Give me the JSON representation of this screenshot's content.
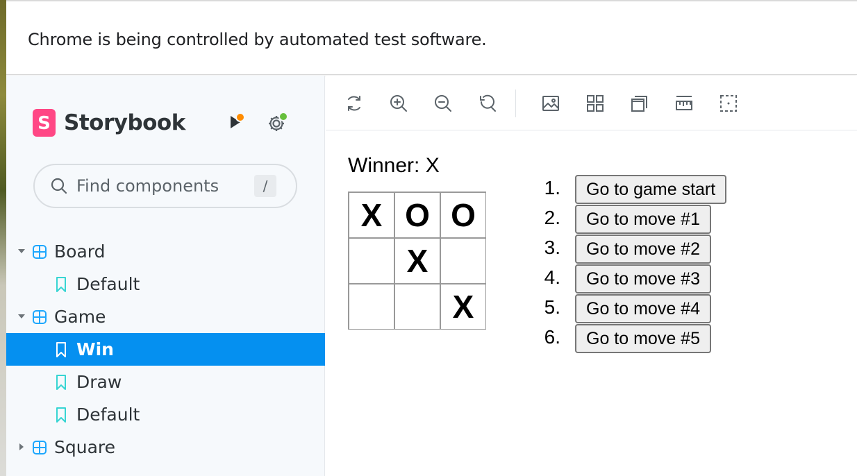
{
  "banner": {
    "text": "Chrome is being controlled by automated test software."
  },
  "sidebar": {
    "brand": "Storybook",
    "logo_letter": "S",
    "search": {
      "placeholder": "Find components",
      "shortcut": "/"
    },
    "tree": [
      {
        "label": "Board",
        "type": "component",
        "expanded": true
      },
      {
        "label": "Default",
        "type": "story"
      },
      {
        "label": "Game",
        "type": "component",
        "expanded": true
      },
      {
        "label": "Win",
        "type": "story",
        "selected": true
      },
      {
        "label": "Draw",
        "type": "story"
      },
      {
        "label": "Default",
        "type": "story"
      },
      {
        "label": "Square",
        "type": "component",
        "expanded": false
      }
    ]
  },
  "toolbar": {
    "icons": [
      "sync-icon",
      "zoom-in-icon",
      "zoom-out-icon",
      "zoom-reset-icon",
      "background-icon",
      "grid-icon",
      "outline-icon",
      "measure-icon",
      "viewport-icon"
    ]
  },
  "game": {
    "status": "Winner: X",
    "squares": [
      "X",
      "O",
      "O",
      "",
      "X",
      "",
      "",
      "",
      "X"
    ],
    "moves": [
      {
        "number": "1.",
        "label": "Go to game start"
      },
      {
        "number": "2.",
        "label": "Go to move #1"
      },
      {
        "number": "3.",
        "label": "Go to move #2"
      },
      {
        "number": "4.",
        "label": "Go to move #3"
      },
      {
        "number": "5.",
        "label": "Go to move #4"
      },
      {
        "number": "6.",
        "label": "Go to move #5"
      }
    ]
  },
  "colors": {
    "accent": "#0590f0",
    "brand": "#ff4785",
    "component_icon": "#1ea7fd",
    "story_icon": "#37d5d3",
    "notification_orange": "#ff8c00",
    "status_green": "#66bf3c"
  }
}
